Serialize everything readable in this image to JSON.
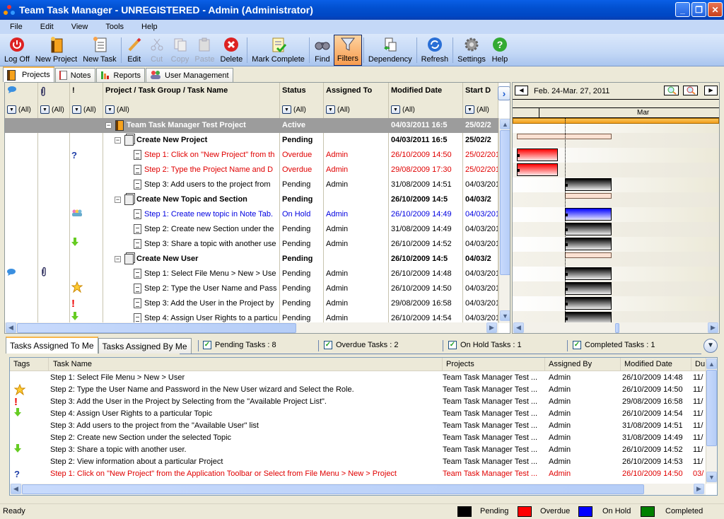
{
  "window": {
    "title": "Team Task Manager - UNREGISTERED - Admin (Administrator)"
  },
  "menu": [
    "File",
    "Edit",
    "View",
    "Tools",
    "Help"
  ],
  "toolbar": [
    {
      "label": "Log Off",
      "icon": "power-icon",
      "state": "normal"
    },
    {
      "label": "New Project",
      "icon": "new-project-icon",
      "state": "normal"
    },
    {
      "label": "New Task",
      "icon": "new-task-icon",
      "state": "normal"
    },
    {
      "label": "Edit",
      "icon": "pencil-icon",
      "state": "normal"
    },
    {
      "label": "Cut",
      "icon": "scissors-icon",
      "state": "disabled"
    },
    {
      "label": "Copy",
      "icon": "copy-icon",
      "state": "disabled"
    },
    {
      "label": "Paste",
      "icon": "paste-icon",
      "state": "disabled"
    },
    {
      "label": "Delete",
      "icon": "delete-icon",
      "state": "normal"
    },
    {
      "label": "Mark Complete",
      "icon": "checklist-icon",
      "state": "normal"
    },
    {
      "label": "Find",
      "icon": "binoculars-icon",
      "state": "normal"
    },
    {
      "label": "Filters",
      "icon": "funnel-icon",
      "state": "active"
    },
    {
      "label": "Dependency",
      "icon": "dependency-icon",
      "state": "normal"
    },
    {
      "label": "Refresh",
      "icon": "refresh-icon",
      "state": "normal"
    },
    {
      "label": "Settings",
      "icon": "gear-icon",
      "state": "normal"
    },
    {
      "label": "Help",
      "icon": "help-icon",
      "state": "normal"
    }
  ],
  "main_tabs": [
    {
      "label": "Projects",
      "active": true
    },
    {
      "label": "Notes",
      "active": false
    },
    {
      "label": "Reports",
      "active": false
    },
    {
      "label": "User Management",
      "active": false
    }
  ],
  "grid": {
    "columns": [
      {
        "label": "",
        "icon": "comment-icon",
        "filter": "(All)"
      },
      {
        "label": "",
        "icon": "paperclip-icon",
        "filter": "(All)"
      },
      {
        "label": "!",
        "icon": "priority-icon",
        "filter": "(All)"
      },
      {
        "label": "Project / Task Group / Task Name",
        "filter": "(All)"
      },
      {
        "label": "Status",
        "filter": "(All)"
      },
      {
        "label": "Assigned To",
        "filter": "(All)"
      },
      {
        "label": "Modified Date",
        "filter": "(All)"
      },
      {
        "label": "Start D",
        "filter": "(All)"
      }
    ],
    "rows": [
      {
        "type": "proj",
        "name": "Team Task Manager Test Project",
        "status": "Active",
        "assigned": "",
        "modified": "04/03/2011 16:5",
        "start": "25/02/2",
        "tag": "",
        "attach": false,
        "comment": false
      },
      {
        "type": "group",
        "name": "Create New Project",
        "status": "Pending",
        "assigned": "",
        "modified": "04/03/2011 16:5",
        "start": "25/02/2",
        "tag": "",
        "attach": false,
        "comment": false
      },
      {
        "type": "task",
        "style": "overdue",
        "name": "Step 1: Click on \"New Project\" from th",
        "status": "Overdue",
        "assigned": "Admin",
        "modified": "26/10/2009 14:50",
        "start": "25/02/201",
        "tag": "question",
        "attach": false,
        "comment": false
      },
      {
        "type": "task",
        "style": "overdue",
        "name": "Step 2: Type the Project Name and D",
        "status": "Overdue",
        "assigned": "Admin",
        "modified": "29/08/2009 17:30",
        "start": "25/02/201",
        "tag": "",
        "attach": false,
        "comment": false
      },
      {
        "type": "task",
        "style": "normal",
        "name": "Step 3: Add users to the project from",
        "status": "Pending",
        "assigned": "Admin",
        "modified": "31/08/2009 14:51",
        "start": "04/03/201",
        "tag": "",
        "attach": false,
        "comment": false
      },
      {
        "type": "group",
        "name": "Create New Topic and Section",
        "status": "Pending",
        "assigned": "",
        "modified": "26/10/2009 14:5",
        "start": "04/03/2",
        "tag": "",
        "attach": false,
        "comment": false
      },
      {
        "type": "task",
        "style": "onhold",
        "name": "Step 1: Create new topic in Note Tab.",
        "status": "On Hold",
        "assigned": "Admin",
        "modified": "26/10/2009 14:49",
        "start": "04/03/201",
        "tag": "users",
        "attach": false,
        "comment": false
      },
      {
        "type": "task",
        "style": "normal",
        "name": "Step 2: Create new Section under the",
        "status": "Pending",
        "assigned": "Admin",
        "modified": "31/08/2009 14:49",
        "start": "04/03/201",
        "tag": "",
        "attach": false,
        "comment": false
      },
      {
        "type": "task",
        "style": "normal",
        "name": "Step 3: Share a topic with another use",
        "status": "Pending",
        "assigned": "Admin",
        "modified": "26/10/2009 14:52",
        "start": "04/03/201",
        "tag": "down",
        "attach": false,
        "comment": false
      },
      {
        "type": "group",
        "name": "Create New User",
        "status": "Pending",
        "assigned": "",
        "modified": "26/10/2009 14:5",
        "start": "04/03/2",
        "tag": "",
        "attach": false,
        "comment": false
      },
      {
        "type": "task",
        "style": "normal",
        "name": "Step 1: Select File Menu > New > Use",
        "status": "Pending",
        "assigned": "Admin",
        "modified": "26/10/2009 14:48",
        "start": "04/03/201",
        "tag": "",
        "attach": true,
        "comment": true
      },
      {
        "type": "task",
        "style": "normal",
        "name": "Step 2: Type the User Name and Pass",
        "status": "Pending",
        "assigned": "Admin",
        "modified": "26/10/2009 14:50",
        "start": "04/03/201",
        "tag": "star",
        "attach": false,
        "comment": false
      },
      {
        "type": "task",
        "style": "normal",
        "name": "Step 3: Add the User in the Project by",
        "status": "Pending",
        "assigned": "Admin",
        "modified": "29/08/2009 16:58",
        "start": "04/03/201",
        "tag": "exclaim",
        "attach": false,
        "comment": false
      },
      {
        "type": "task",
        "style": "normal",
        "name": "Step 4: Assign User Rights to a particu",
        "status": "Pending",
        "assigned": "Admin",
        "modified": "26/10/2009 14:54",
        "start": "04/03/201",
        "tag": "down",
        "attach": false,
        "comment": false
      }
    ]
  },
  "gantt": {
    "range_label": "Feb. 24-Mar. 27, 2011",
    "month_label": "Mar",
    "bars": [
      {
        "kind": "summary-project"
      },
      {
        "kind": "summary",
        "start": 0.02,
        "end": 0.48
      },
      {
        "kind": "bar",
        "color": "overdue",
        "start": 0.02,
        "end": 0.22
      },
      {
        "kind": "bar",
        "color": "overdue",
        "start": 0.02,
        "end": 0.22
      },
      {
        "kind": "bar",
        "color": "pending",
        "start": 0.255,
        "end": 0.48
      },
      {
        "kind": "summary",
        "start": 0.255,
        "end": 0.48
      },
      {
        "kind": "bar",
        "color": "onhold",
        "start": 0.255,
        "end": 0.48
      },
      {
        "kind": "bar",
        "color": "pending",
        "start": 0.255,
        "end": 0.48
      },
      {
        "kind": "bar",
        "color": "pending",
        "start": 0.255,
        "end": 0.48
      },
      {
        "kind": "summary",
        "start": 0.255,
        "end": 0.48
      },
      {
        "kind": "bar",
        "color": "pending",
        "start": 0.255,
        "end": 0.48
      },
      {
        "kind": "bar",
        "color": "pending",
        "start": 0.255,
        "end": 0.48
      },
      {
        "kind": "bar",
        "color": "pending",
        "start": 0.255,
        "end": 0.48
      },
      {
        "kind": "bar",
        "color": "pending",
        "start": 0.255,
        "end": 0.48
      }
    ]
  },
  "bottom": {
    "tabs": [
      {
        "label": "Tasks Assigned To Me",
        "active": true
      },
      {
        "label": "Tasks Assigned By Me",
        "active": false
      }
    ],
    "filters": [
      {
        "label": "Pending Tasks : 8",
        "checked": true
      },
      {
        "label": "Overdue Tasks : 2",
        "checked": true
      },
      {
        "label": "On Hold Tasks : 1",
        "checked": true
      },
      {
        "label": "Completed Tasks : 1",
        "checked": true
      }
    ],
    "columns": [
      "Tags",
      "Task Name",
      "Projects",
      "Assigned By",
      "Modified Date",
      "Du"
    ],
    "rows": [
      {
        "tag": "",
        "name": "Step 1: Select File Menu > New > User",
        "project": "Team Task Manager Test ...",
        "by": "Admin",
        "modified": "26/10/2009 14:48",
        "due": "11/",
        "style": "normal"
      },
      {
        "tag": "star",
        "name": "Step 2: Type the User Name and Password in the New User wizard and Select the Role.",
        "project": "Team Task Manager Test ...",
        "by": "Admin",
        "modified": "26/10/2009 14:50",
        "due": "11/",
        "style": "normal"
      },
      {
        "tag": "exclaim",
        "name": "Step 3: Add the User in the Project by Selecting from the \"Available Project List\".",
        "project": "Team Task Manager Test ...",
        "by": "Admin",
        "modified": "29/08/2009 16:58",
        "due": "11/",
        "style": "normal"
      },
      {
        "tag": "down",
        "name": "Step 4: Assign User Rights to a particular Topic",
        "project": "Team Task Manager Test ...",
        "by": "Admin",
        "modified": "26/10/2009 14:54",
        "due": "11/",
        "style": "normal"
      },
      {
        "tag": "",
        "name": "Step 3: Add users to the project from the \"Available User\" list",
        "project": "Team Task Manager Test ...",
        "by": "Admin",
        "modified": "31/08/2009 14:51",
        "due": "11/",
        "style": "normal"
      },
      {
        "tag": "",
        "name": "Step 2: Create new Section under the selected Topic",
        "project": "Team Task Manager Test ...",
        "by": "Admin",
        "modified": "31/08/2009 14:49",
        "due": "11/",
        "style": "normal"
      },
      {
        "tag": "down",
        "name": "Step 3: Share a topic with another user.",
        "project": "Team Task Manager Test ...",
        "by": "Admin",
        "modified": "26/10/2009 14:52",
        "due": "11/",
        "style": "normal"
      },
      {
        "tag": "",
        "name": "Step 2: View information about a particular Project",
        "project": "Team Task Manager Test ...",
        "by": "Admin",
        "modified": "26/10/2009 14:53",
        "due": "11/",
        "style": "normal"
      },
      {
        "tag": "question",
        "name": "Step 1: Click on \"New Project\" from the Application Toolbar or Select from File Menu > New > Project",
        "project": "Team Task Manager Test ...",
        "by": "Admin",
        "modified": "26/10/2009 14:50",
        "due": "03/",
        "style": "overdue"
      }
    ]
  },
  "status": {
    "text": "Ready",
    "legend": [
      {
        "label": "Pending",
        "color": "#000000"
      },
      {
        "label": "Overdue",
        "color": "#ff0000"
      },
      {
        "label": "On Hold",
        "color": "#0000ff"
      },
      {
        "label": "Completed",
        "color": "#008000"
      }
    ]
  }
}
